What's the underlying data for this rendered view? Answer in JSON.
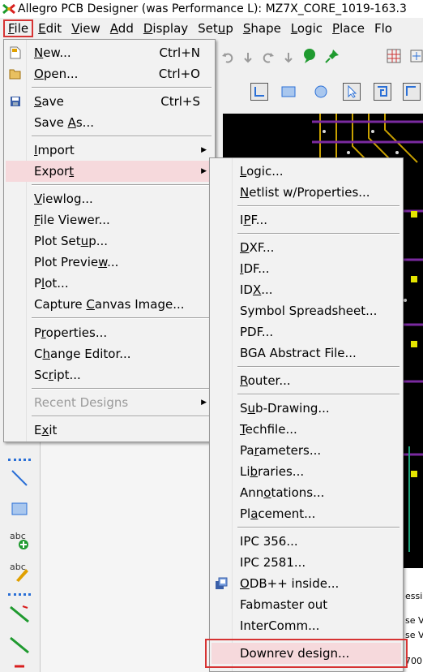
{
  "window": {
    "title": "Allegro PCB Designer (was Performance L): MZ7X_CORE_1019-163.3",
    "app_icon": "allegro-logo-icon"
  },
  "menubar": [
    {
      "label": "File",
      "key": "F",
      "rest": "ile",
      "active": true
    },
    {
      "label": "Edit",
      "key": "E",
      "rest": "dit"
    },
    {
      "label": "View",
      "key": "V",
      "rest": "iew"
    },
    {
      "label": "Add",
      "key": "A",
      "rest": "dd"
    },
    {
      "label": "Display",
      "key": "D",
      "rest": "isplay"
    },
    {
      "label": "Setup",
      "pre": "Set",
      "key": "u",
      "rest": "p"
    },
    {
      "label": "Shape",
      "key": "S",
      "rest": "hape"
    },
    {
      "label": "Logic",
      "key": "L",
      "rest": "ogic"
    },
    {
      "label": "Place",
      "key": "P",
      "rest": "lace"
    },
    {
      "label": "Flow",
      "pre": "Flo",
      "key": "",
      "rest": ""
    }
  ],
  "file_menu": {
    "new": {
      "key": "N",
      "rest": "ew...",
      "shortcut": "Ctrl+N"
    },
    "open": {
      "key": "O",
      "rest": "pen...",
      "shortcut": "Ctrl+O"
    },
    "save": {
      "key": "S",
      "rest": "ave",
      "shortcut": "Ctrl+S"
    },
    "save_as": {
      "pre": "Save ",
      "key": "A",
      "rest": "s..."
    },
    "import": {
      "key": "I",
      "rest": "mport"
    },
    "export": {
      "pre": "Expor",
      "key": "t",
      "rest": ""
    },
    "viewlog": {
      "key": "V",
      "rest": "iewlog..."
    },
    "file_viewer": {
      "key": "F",
      "rest": "ile Viewer..."
    },
    "plot_setup": {
      "pre": "Plot Set",
      "key": "u",
      "rest": "p..."
    },
    "plot_preview": {
      "pre": "Plot Previe",
      "key": "w",
      "rest": "..."
    },
    "plot": {
      "pre": "P",
      "key": "l",
      "rest": "ot..."
    },
    "capture_canvas": {
      "pre": "Capture ",
      "key": "C",
      "rest": "anvas Image..."
    },
    "properties": {
      "pre": "P",
      "key": "r",
      "rest": "operties..."
    },
    "change_editor": {
      "pre": "C",
      "key": "h",
      "rest": "ange Editor..."
    },
    "script": {
      "pre": "Sc",
      "key": "r",
      "rest": "ipt..."
    },
    "recent_designs": "Recent Designs",
    "exit": {
      "pre": "E",
      "key": "x",
      "rest": "it"
    }
  },
  "export_menu": {
    "logic": {
      "key": "L",
      "rest": "ogic..."
    },
    "netlist": {
      "key": "N",
      "rest": "etlist w/Properties..."
    },
    "ipf": {
      "pre": "I",
      "key": "P",
      "rest": "F..."
    },
    "dxf": {
      "key": "D",
      "rest": "XF..."
    },
    "idf": {
      "key": "I",
      "rest": "DF..."
    },
    "idx": {
      "pre": "ID",
      "key": "X",
      "rest": "..."
    },
    "symbol_spreadsheet": "Symbol Spreadsheet...",
    "pdf": "PDF...",
    "bga_abstract": "BGA Abstract File...",
    "router": {
      "key": "R",
      "rest": "outer..."
    },
    "sub_drawing": {
      "pre": "S",
      "key": "u",
      "rest": "b-Drawing..."
    },
    "techfile": {
      "key": "T",
      "rest": "echfile..."
    },
    "parameters": {
      "pre": "Pa",
      "key": "r",
      "rest": "ameters..."
    },
    "libraries": {
      "pre": "Li",
      "key": "b",
      "rest": "raries..."
    },
    "annotations": {
      "pre": "Ann",
      "key": "o",
      "rest": "tations..."
    },
    "placement": {
      "pre": "Pl",
      "key": "a",
      "rest": "cement..."
    },
    "ipc356": "IPC 356...",
    "ipc2581": "IPC 2581...",
    "odb": {
      "key": "O",
      "rest": "DB++ inside..."
    },
    "fabmaster": "Fabmaster out",
    "intercomm": "InterComm...",
    "downrev": "Downrev design..."
  },
  "log_panel": [
    "essin",
    "se V",
    "se V",
    "700"
  ],
  "colors": {
    "highlight": "#f6d9dc",
    "annotation_red": "#d63333",
    "canvas_bg": "#000000",
    "menu_bg": "#f2f2f2"
  }
}
